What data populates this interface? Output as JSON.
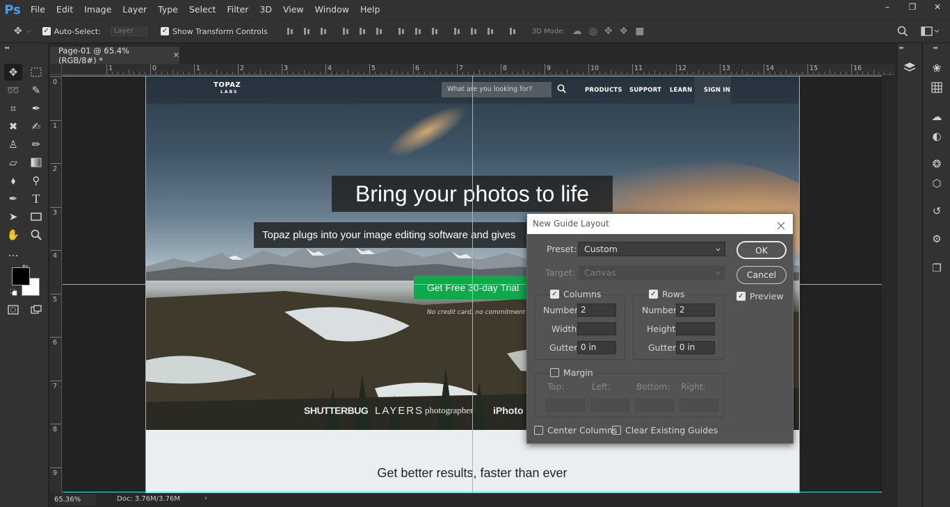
{
  "app": {
    "logo": "Ps",
    "menu": [
      "File",
      "Edit",
      "Image",
      "Layer",
      "Type",
      "Select",
      "Filter",
      "3D",
      "View",
      "Window",
      "Help"
    ],
    "window_controls": [
      "minimize-icon",
      "restore-icon",
      "close-icon"
    ]
  },
  "options": {
    "auto_select_label": "Auto-Select:",
    "auto_select_checked": true,
    "auto_select_value": "Layer",
    "transform_controls_label": "Show Transform Controls",
    "transform_controls_checked": true,
    "mode_3d_label": "3D Mode:"
  },
  "document": {
    "tab_title": "Page-01 @ 65.4% (RGB/8#) *",
    "zoom": "65.36%",
    "doc_size": "Doc: 3.76M/3.76M"
  },
  "ruler": {
    "h_labels": [
      "1",
      "0",
      "1",
      "2",
      "3",
      "4",
      "5",
      "6",
      "7",
      "8",
      "9",
      "10",
      "11",
      "12",
      "13",
      "14",
      "15",
      "16"
    ],
    "v_labels": [
      "0",
      "1",
      "2",
      "3",
      "4",
      "5",
      "6",
      "7",
      "8",
      "9"
    ]
  },
  "website": {
    "logo": "TOPAZ",
    "logo_sub": "LABS",
    "search_placeholder": "What are you looking for?",
    "nav": [
      "PRODUCTS",
      "SUPPORT",
      "LEARN",
      "SIGN IN"
    ],
    "headline": "Bring your photos to life",
    "subheadline": "Topaz plugs into your image editing software and gives",
    "cta": "Get Free 30-day Trial",
    "cta_color": "#0fa84a",
    "no_card": "No credit card, no commitment",
    "brands": [
      "SHUTTERBUG",
      "LAYERS",
      "photographer",
      "iPhoto"
    ],
    "tagline": "Get better results, faster than ever"
  },
  "dialog": {
    "title": "New Guide Layout",
    "preset_label": "Preset:",
    "preset_value": "Custom",
    "target_label": "Target:",
    "target_value": "Canvas",
    "ok": "OK",
    "cancel": "Cancel",
    "preview_label": "Preview",
    "preview_checked": true,
    "columns": {
      "label": "Columns",
      "checked": true,
      "number_label": "Number",
      "number": "2",
      "width_label": "Width",
      "width": "",
      "gutter_label": "Gutter",
      "gutter": "0 in"
    },
    "rows": {
      "label": "Rows",
      "checked": true,
      "number_label": "Number",
      "number": "2",
      "height_label": "Height",
      "height": "",
      "gutter_label": "Gutter",
      "gutter": "0 in"
    },
    "margin": {
      "label": "Margin",
      "checked": false,
      "top_label": "Top:",
      "left_label": "Left:",
      "bottom_label": "Bottom:",
      "right_label": "Right:"
    },
    "center_columns_label": "Center Columns",
    "center_columns_checked": false,
    "clear_guides_label": "Clear Existing Guides",
    "clear_guides_checked": false
  },
  "colors": {
    "guide": "#3de0e6",
    "foreground": "#000000",
    "background": "#ffffff",
    "accent": "#4a9fe6"
  }
}
